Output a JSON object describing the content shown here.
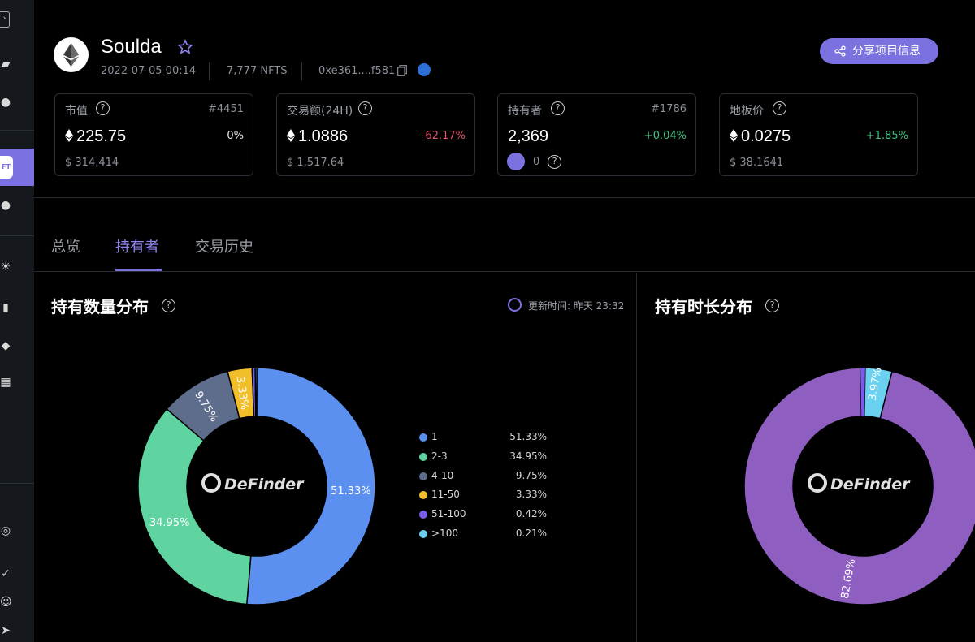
{
  "project": {
    "name": "Soulda",
    "date": "2022-07-05 00:14",
    "supply": "7,777 NFTS",
    "contract": "0xe361....f581",
    "share_label": "分享项目信息"
  },
  "stats": [
    {
      "label": "市值",
      "rank": "#4451",
      "value": "225.75",
      "change": "0%",
      "usd": "$ 314,414",
      "has_eth": true
    },
    {
      "label": "交易额(24H)",
      "rank": "",
      "value": "1.0886",
      "change": "-62.17%",
      "usd": "$ 1,517.64",
      "has_eth": true
    },
    {
      "label": "持有者",
      "rank": "#1786",
      "value": "2,369",
      "change": "+0.04%",
      "extra": "0",
      "has_eth": false
    },
    {
      "label": "地板价",
      "rank": "",
      "value": "0.0275",
      "change": "+1.85%",
      "usd": "$ 38.1641",
      "has_eth": true
    }
  ],
  "tabs": [
    "总览",
    "持有者",
    "交易历史"
  ],
  "panels": {
    "left_title": "持有数量分布",
    "right_title": "持有时长分布",
    "update_text": "更新时间: 昨天 23:32",
    "watermark": "DeFinder"
  },
  "colors": {
    "accent": "#7b72e0",
    "positive": "#3ec07e",
    "negative": "#e0506a",
    "series": [
      "#5b8ff0",
      "#5fd4a0",
      "#5e6d8c",
      "#f2be2a",
      "#7b5ce8",
      "#6ad2f0"
    ],
    "right_series": [
      "#8e5ec0",
      "#6ad2f0",
      "#7b5ce8"
    ]
  },
  "chart_data": [
    {
      "type": "pie",
      "title": "持有数量分布",
      "categories": [
        "1",
        "2-3",
        "4-10",
        "11-50",
        "51-100",
        ">100"
      ],
      "values": [
        51.33,
        34.95,
        9.75,
        3.33,
        0.42,
        0.21
      ],
      "labels": [
        "51.33%",
        "34.95%",
        "9.75%",
        "3.33%",
        "0.42%",
        "0.21%"
      ]
    },
    {
      "type": "pie",
      "title": "持有时长分布",
      "values_visible": [
        {
          "label": "3.97%",
          "value": 3.97
        },
        {
          "label": "82.69%",
          "value": 82.69
        }
      ]
    }
  ]
}
